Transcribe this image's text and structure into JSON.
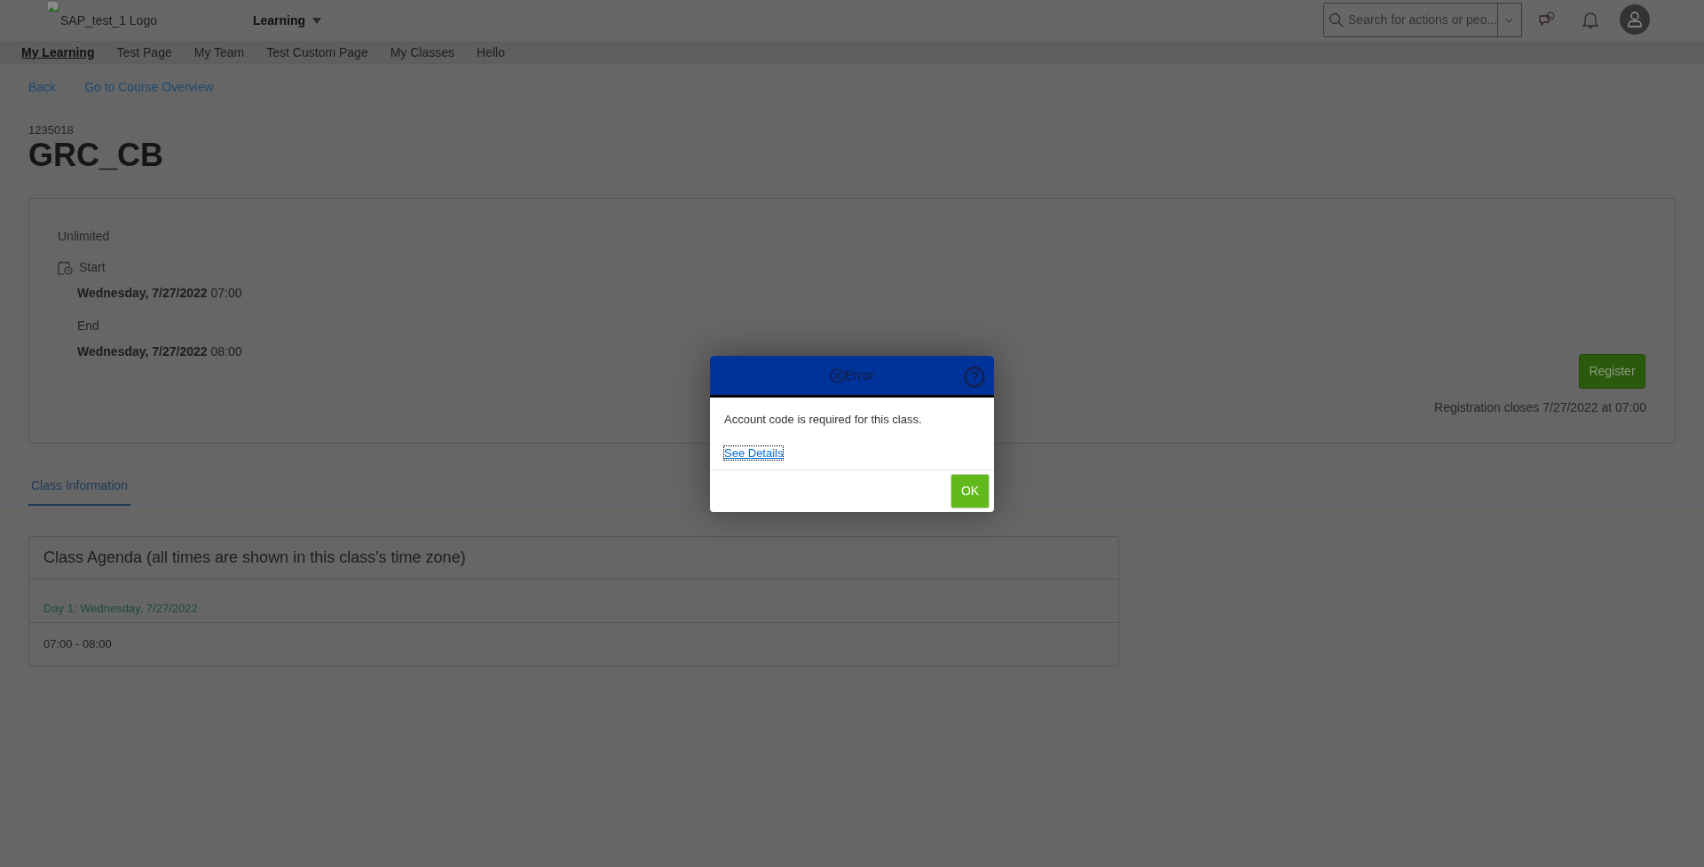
{
  "header": {
    "logo_alt": "SAP_test_1 Logo",
    "app_menu": "Learning",
    "search": {
      "placeholder": "Search for actions or peo..."
    }
  },
  "nav": [
    {
      "label": "My Learning",
      "selected": true
    },
    {
      "label": "Test Page",
      "selected": false
    },
    {
      "label": "My Team",
      "selected": false
    },
    {
      "label": "Test Custom Page",
      "selected": false
    },
    {
      "label": "My Classes",
      "selected": false
    },
    {
      "label": "Hello",
      "selected": false
    }
  ],
  "links": [
    "Back",
    "Go to Course Overview"
  ],
  "course": {
    "code": "1235018",
    "title": "GRC_CB"
  },
  "schedule": {
    "availability": "Unlimited",
    "start_label": "Start",
    "start": "**Wednesday, 7/27/2022** 07:00",
    "end_label": "End",
    "end": "**Wednesday, 7/27/2022** 08:00"
  },
  "register_button": "Register",
  "registration_note": "Registration closes 7/27/2022 at 07:00",
  "tabs": [
    {
      "label": "Class Information",
      "selected": true
    }
  ],
  "agenda": {
    "title": "Class Agenda (all times are shown in this class's time zone)",
    "days": [
      {
        "label": "Day 1: Wednesday, 7/27/2022",
        "sessions": [
          "07:00 - 08:00"
        ]
      }
    ]
  },
  "dialog": {
    "title": "Error",
    "message": "Account code is required for this class.",
    "link": "See Details",
    "ok": "OK"
  }
}
